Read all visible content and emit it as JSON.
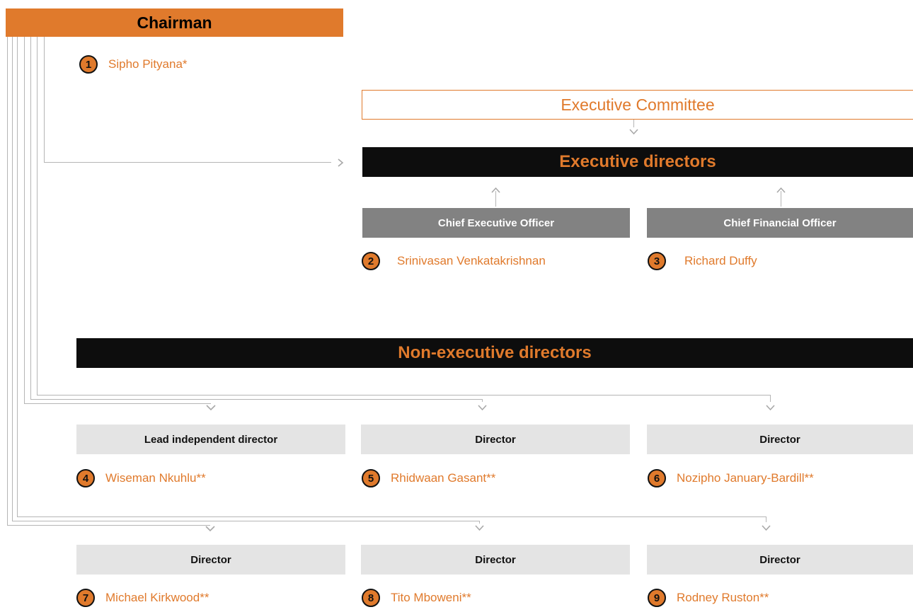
{
  "colors": {
    "orange": "#e07a2c",
    "line": "#b5b5b5"
  },
  "chairman": {
    "title": "Chairman",
    "badge": "1",
    "name": "Sipho Pityana*"
  },
  "exco": {
    "label": "Executive Committee"
  },
  "executive": {
    "title": "Executive directors",
    "members": [
      {
        "role": "Chief Executive Officer",
        "badge": "2",
        "name": "Srinivasan Venkatakrishnan"
      },
      {
        "role": "Chief Financial Officer",
        "badge": "3",
        "name": "Richard Duffy"
      }
    ]
  },
  "nonexecutive": {
    "title": "Non-executive directors",
    "members": [
      {
        "role": "Lead independent director",
        "badge": "4",
        "name": "Wiseman Nkuhlu**"
      },
      {
        "role": "Director",
        "badge": "5",
        "name": "Rhidwaan Gasant**"
      },
      {
        "role": "Director",
        "badge": "6",
        "name": "Nozipho January-Bardill**"
      },
      {
        "role": "Director",
        "badge": "7",
        "name": "Michael Kirkwood**"
      },
      {
        "role": "Director",
        "badge": "8",
        "name": "Tito Mboweni**"
      },
      {
        "role": "Director",
        "badge": "9",
        "name": "Rodney Ruston**"
      }
    ]
  },
  "icons": {
    "arrow_down": "chevron-down-icon",
    "arrow_up": "arrow-up-icon",
    "arrow_right": "chevron-right-icon"
  }
}
